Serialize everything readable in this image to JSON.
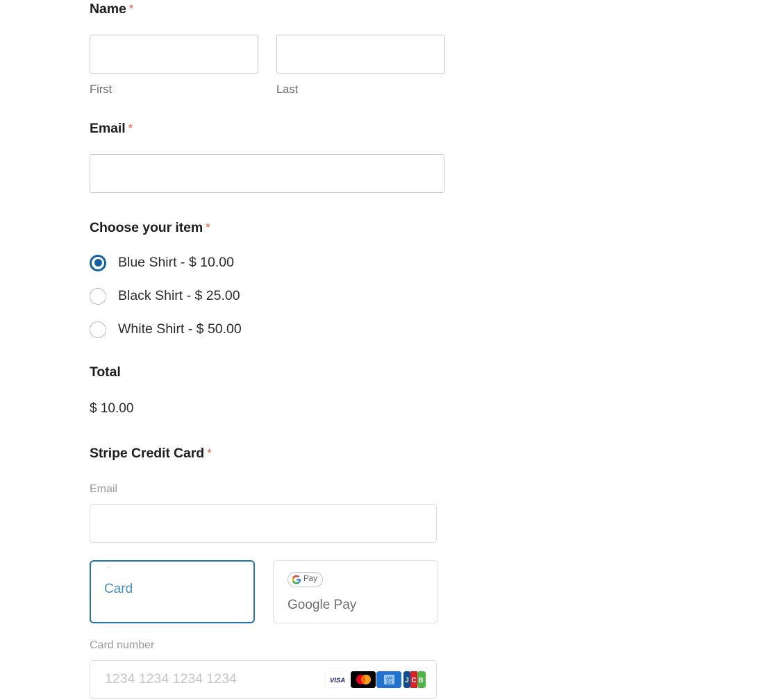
{
  "form": {
    "name": {
      "label": "Name",
      "required_marker": "*",
      "first": {
        "value": "",
        "placeholder": "",
        "sublabel": "First"
      },
      "last": {
        "value": "",
        "placeholder": "",
        "sublabel": "Last"
      }
    },
    "email": {
      "label": "Email",
      "required_marker": "*",
      "value": "",
      "placeholder": ""
    },
    "choose_item": {
      "label": "Choose your item",
      "required_marker": "*",
      "options": [
        {
          "label": "Blue Shirt - $ 10.00",
          "selected": true
        },
        {
          "label": "Black Shirt - $ 25.00",
          "selected": false
        },
        {
          "label": "White Shirt - $ 50.00",
          "selected": false
        }
      ]
    },
    "total": {
      "label": "Total",
      "value": "$ 10.00"
    },
    "stripe": {
      "label": "Stripe Credit Card",
      "required_marker": "*",
      "email": {
        "sublabel": "Email",
        "value": "",
        "placeholder": ""
      },
      "payment_methods": [
        {
          "label": "Card",
          "icon": "credit-card-icon",
          "selected": true
        },
        {
          "label": "Google Pay",
          "icon": "google-pay-icon",
          "selected": false
        }
      ],
      "gpay_logo_text": "Pay",
      "gpay_logo_letter": "G",
      "card_number": {
        "sublabel": "Card number",
        "value": "",
        "placeholder": "1234 1234 1234 1234"
      },
      "accepted_brands": [
        "visa",
        "mastercard",
        "amex",
        "jcb"
      ],
      "brand_labels": {
        "visa": "VISA",
        "amex_line1": "AM",
        "amex_line2": "EX",
        "jcb_j": "J",
        "jcb_c": "C",
        "jcb_b": "B"
      }
    }
  },
  "colors": {
    "required_asterisk": "#e8563f",
    "radio_selected": "#11649f",
    "tab_selected_border": "#1f74b6",
    "tab_selected_text": "#4590cf",
    "input_border": "#c9c9c9",
    "stripe_border": "#dedede"
  }
}
